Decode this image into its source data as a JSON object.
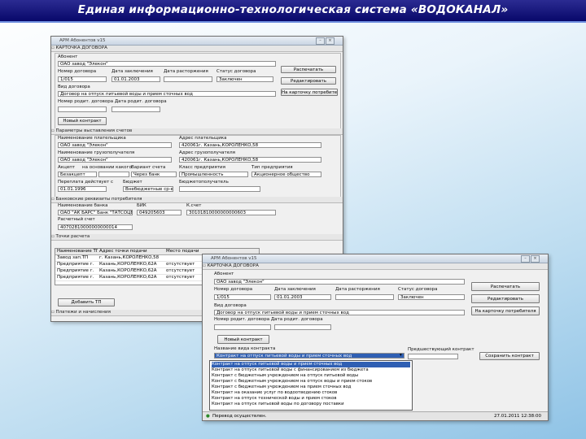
{
  "slide": {
    "title": "Единая информационно-технологическая система «ВОДОКАНАЛ»"
  },
  "win1": {
    "title": "АРМ Абонентов v15",
    "sec_card": "КАРТОЧКА ДОГОВОРА",
    "abonent_label": "Абонент",
    "abonent_value": "ОАО завод \"Элекон\"",
    "col_labels": [
      "Номер договора",
      "Дата заключения",
      "Дата расторжения",
      "Статус договора"
    ],
    "col_values": [
      "1/015",
      "01.01.2003",
      "",
      "Заключен"
    ],
    "btn_print": "Распечатать",
    "btn_edit": "Редактировать",
    "btn_consumer": "На карточку потребителя",
    "kind_label": "Вид договора",
    "kind_value": "Договор на отпуск питьевой воды и прием сточных вод",
    "nums_label": "Номер родит. договора  Дата родит. договора",
    "new_contract": "Новый контракт",
    "sec_params": "Параметры выставления счетов",
    "payer_label": "Наименование плательщика",
    "payer_value": "ОАО завод \"Элекон\"",
    "payer_addr_label": "Адрес плательщика",
    "payer_addr_value": "420061г. Казань,КОРОЛЕНКО,58",
    "consignee_label": "Наименование грузополучателя",
    "consignee_value": "ОАО завод \"Элекон\"",
    "consignee_addr_label": "Адрес грузополучателя",
    "consignee_addr_value": "420061г. Казань,КОРОЛЕНКО,58",
    "row4_labels": [
      "Акцепт",
      "на основании какого",
      "Вариант счета",
      "Класс предприятия",
      "Тип предприятия"
    ],
    "row4_values": [
      "Безакцепт",
      "",
      "Через банк",
      "Промышленность",
      "Акционерное общество"
    ],
    "row5_labels": [
      "Переплата действует с",
      "Бюджет",
      "Бюджетополучатель"
    ],
    "row5_values": [
      "01.01.1996",
      "Внебюджетные ср-ва",
      ""
    ],
    "sec_bank": "Банковские реквизиты потребителя",
    "bank_label": "Наименование банка",
    "bank_value": "ОАО \"АК БАРС\" Банк \"ТАТСОЦБАНК\" г. Казань",
    "bik_label": "БИК",
    "bik_value": "049205603",
    "ks_label": "К.счет",
    "ks_value": "30101810000000000603",
    "rs_label": "Расчетный счет",
    "rs_value": "40702810000000000014",
    "sec_points": "Точки расчета",
    "pts_headers": [
      "Наименование ТП",
      "Адрес точки подачи",
      "Место подачи"
    ],
    "pts_rows": [
      [
        "Завод зап.ТП",
        "г. Казань,КОРОЛЕНКО,58",
        ""
      ],
      [
        "Предприятие г.",
        "Казань,КОРОЛЕНКО,62А",
        "отсутствует"
      ],
      [
        "Предприятие г.",
        "Казань,КОРОЛЕНКО,62А",
        "отсутствует"
      ],
      [
        "Предприятие г.",
        "Казань,КОРОЛЕНКО,62А",
        "отсутствует"
      ]
    ],
    "btn_add_tp": "Добавить ТП",
    "sec_more": "Платежи и начисления"
  },
  "win2": {
    "title": "АРМ Абонентов v15",
    "sec_card": "КАРТОЧКА ДОГОВОРА",
    "abonent_label": "Абонент",
    "abonent_value": "ОАО завод \"Элекон\"",
    "col_labels": [
      "Номер договора",
      "Дата заключения",
      "Дата расторжения",
      "Статус договора"
    ],
    "col_values": [
      "1/015",
      "01.01.2003",
      "",
      "Заключен"
    ],
    "btn_print": "Распечатать",
    "btn_edit": "Редактировать",
    "btn_consumer": "На карточку потребителя",
    "kind_label": "Вид договора",
    "kind_value": "Договор на отпуск питьевой воды и прием сточных вод",
    "nums_label": "Номер родит. договора  Дата родит. договора",
    "new_contract": "Новый контракт",
    "dd_label": "Название вида контракта",
    "dd_value": "Контракт на отпуск питьевой воды и прием сточных вод",
    "side_label": "Предшествующий контракт",
    "btn_save": "Сохранить контракт",
    "dd_items": [
      "Контракт на отпуск питьевой воды и прием сточных вод ",
      "Контракт на отпуск питьевой воды с финансированием из бюджета",
      "Контракт с бюджетным учреждением на отпуск питьевой воды",
      "Контракт с бюджетным учреждением на отпуск воды и прием стоков",
      "Контракт с бюджетным учреждением на прием сточных вод",
      "Контракт на оказание услуг по водоотведению стоков",
      "Контракт на отпуск технической воды и прием стоков",
      "Контракт на отпуск питьевой воды по договору поставки"
    ],
    "status": "Перевод осуществлен.",
    "status_right": "27.01.2011 12:38:00"
  }
}
